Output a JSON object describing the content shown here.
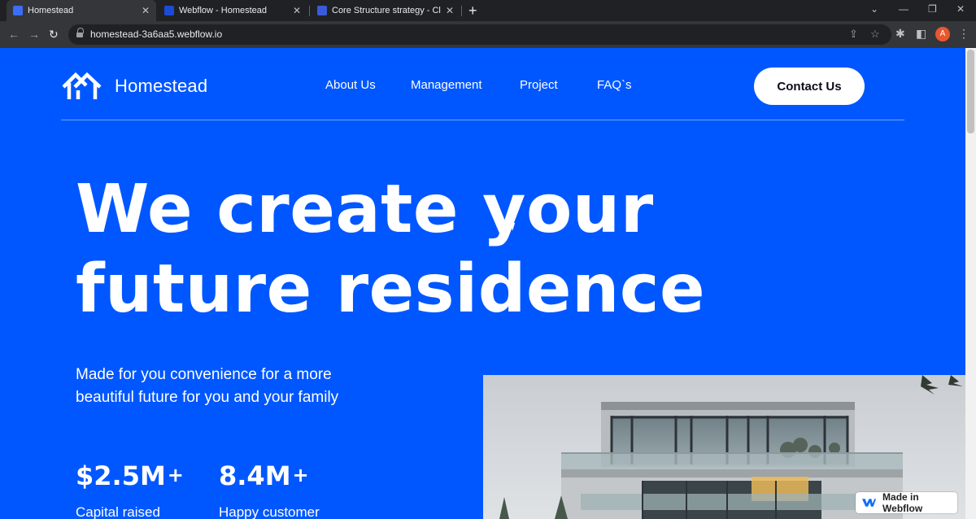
{
  "browser": {
    "tabs": [
      {
        "label": "Homestead",
        "active": true,
        "icon": "homestead-favicon"
      },
      {
        "label": "Webflow - Homestead",
        "active": false,
        "icon": "webflow-favicon"
      },
      {
        "label": "Core Structure strategy - Client-",
        "active": false,
        "icon": "doc-favicon"
      }
    ],
    "url": "homestead-3a6aa5.webflow.io",
    "profile_initial": "A"
  },
  "site": {
    "brand": "Homestead",
    "nav": [
      "About Us",
      "Management",
      "Project",
      "FAQ`s"
    ],
    "cta": "Contact Us",
    "headline_line1": "We create your",
    "headline_line2": "future residence",
    "subtext": "Made for you convenience for a more beautiful future for you and your family",
    "stats": [
      {
        "value": "$2.5M",
        "suffix": "+",
        "label": "Capital raised"
      },
      {
        "value": "8.4M",
        "suffix": "+",
        "label": "Happy customer"
      }
    ],
    "badge": "Made in Webflow"
  },
  "colors": {
    "brand_blue": "#0057ff",
    "button_bg": "#ffffff",
    "chrome_dark": "#202124"
  }
}
